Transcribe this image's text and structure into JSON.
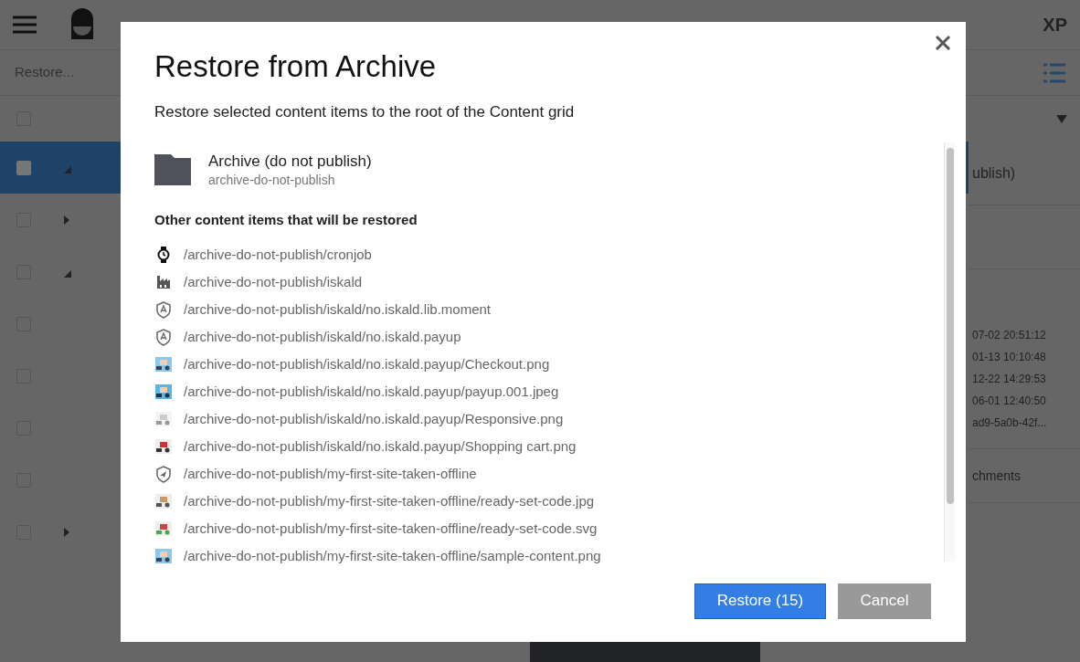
{
  "background": {
    "toolbar": {
      "action": "Restore..."
    },
    "brand": "XP",
    "side_panel": {
      "title_fragment": "ublish)",
      "dates": [
        "07-02 20:51:12",
        "01-13 10:10:48",
        "12-22 14:29:53",
        "06-01 12:40:50",
        "ad9-5a0b-42f..."
      ],
      "section_fragment": "chments"
    },
    "header_checkbox": {
      "checked": false
    },
    "grid_rows": [
      {
        "selected": true,
        "checked": true,
        "has_children": true,
        "expanded": true
      },
      {
        "selected": false,
        "checked": false,
        "has_children": true,
        "expanded": false
      },
      {
        "selected": false,
        "checked": false,
        "has_children": true,
        "expanded": true
      },
      {
        "selected": false,
        "checked": false,
        "has_children": false
      },
      {
        "selected": false,
        "checked": false,
        "has_children": false
      },
      {
        "selected": false,
        "checked": false,
        "has_children": false
      },
      {
        "selected": false,
        "checked": false,
        "has_children": false
      },
      {
        "selected": false,
        "checked": false,
        "has_children": true,
        "expanded": false
      }
    ]
  },
  "dialog": {
    "title": "Restore from Archive",
    "subtitle": "Restore selected content items to the root of the Content grid",
    "main_item": {
      "name": "Archive (do not publish)",
      "path": "archive-do-not-publish"
    },
    "dependants_heading": "Other content items that will be restored",
    "items": [
      {
        "kind": "job",
        "path": "/archive-do-not-publish/cronjob"
      },
      {
        "kind": "app",
        "path": "/archive-do-not-publish/iskald"
      },
      {
        "kind": "shield",
        "path": "/archive-do-not-publish/iskald/no.iskald.lib.moment"
      },
      {
        "kind": "shield",
        "path": "/archive-do-not-publish/iskald/no.iskald.payup"
      },
      {
        "path": "/archive-do-not-publish/iskald/no.iskald.payup/Checkout.png"
      },
      {
        "path": "/archive-do-not-publish/iskald/no.iskald.payup/payup.001.jpeg"
      },
      {
        "path": "/archive-do-not-publish/iskald/no.iskald.payup/Responsive.png"
      },
      {
        "path": "/archive-do-not-publish/iskald/no.iskald.payup/Shopping cart.png"
      },
      {
        "kind": "site",
        "path": "/archive-do-not-publish/my-first-site-taken-offline"
      },
      {
        "path": "/archive-do-not-publish/my-first-site-taken-offline/ready-set-code.jpg"
      },
      {
        "path": "/archive-do-not-publish/my-first-site-taken-offline/ready-set-code.svg"
      },
      {
        "path": "/archive-do-not-publish/my-first-site-taken-offline/sample-content.png"
      }
    ],
    "buttons": [
      {
        "kind": "primary",
        "label": "Restore (15)"
      },
      {
        "kind": "secondary",
        "label": "Cancel"
      }
    ]
  }
}
